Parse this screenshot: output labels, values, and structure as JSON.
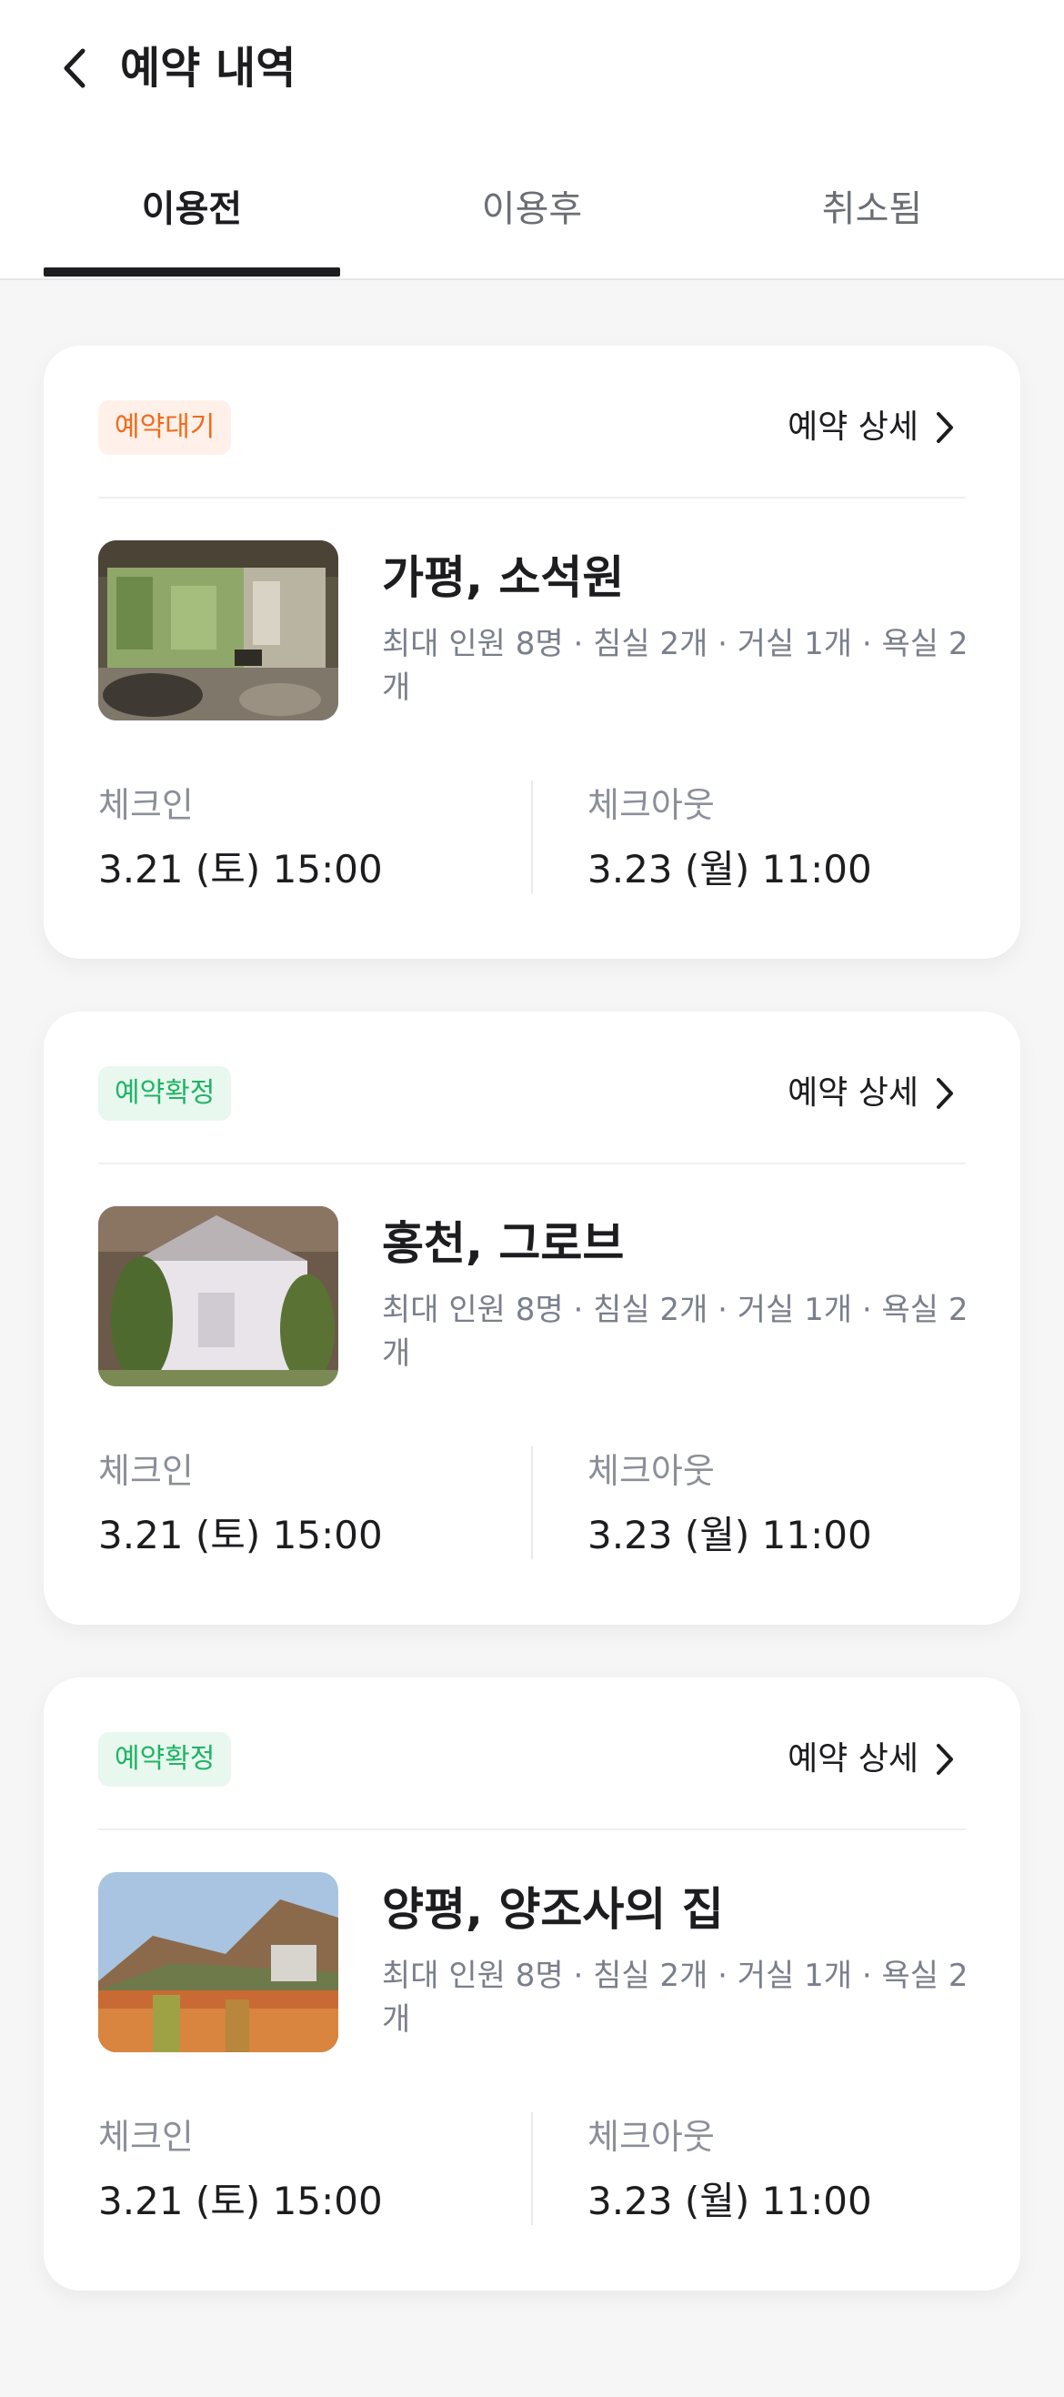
{
  "header": {
    "title": "예약 내역"
  },
  "tabs": [
    {
      "label": "이용전",
      "active": true
    },
    {
      "label": "이용후",
      "active": false
    },
    {
      "label": "취소됨",
      "active": false
    }
  ],
  "colors": {
    "pending_badge_text": "#f26a1b",
    "pending_badge_bg": "#fff1e9",
    "confirmed_badge_text": "#1fb464",
    "confirmed_badge_bg": "#e8f8ef"
  },
  "reservations": [
    {
      "status": "예약대기",
      "status_type": "pending",
      "detail_label": "예약 상세",
      "name": "가평, 소석원",
      "info": "최대 인원 8명 · 침실 2개 · 거실 1개 · 욕실 2개",
      "checkin_label": "체크인",
      "checkin": "3.21 (토) 15:00",
      "checkout_label": "체크아웃",
      "checkout": "3.23 (월) 11:00",
      "image": "living-room-photo"
    },
    {
      "status": "예약확정",
      "status_type": "confirmed",
      "detail_label": "예약 상세",
      "name": "홍천, 그로브",
      "info": "최대 인원 8명 · 침실 2개 · 거실 1개 · 욕실 2개",
      "checkin_label": "체크인",
      "checkin": "3.21 (토) 15:00",
      "checkout_label": "체크아웃",
      "checkout": "3.23 (월) 11:00",
      "image": "white-house-photo"
    },
    {
      "status": "예약확정",
      "status_type": "confirmed",
      "detail_label": "예약 상세",
      "name": "양평, 양조사의 집",
      "info": "최대 인원 8명 · 침실 2개 · 거실 1개 · 욕실 2개",
      "checkin_label": "체크인",
      "checkin": "3.21 (토) 15:00",
      "checkout_label": "체크아웃",
      "checkout": "3.23 (월) 11:00",
      "image": "autumn-field-photo"
    }
  ]
}
